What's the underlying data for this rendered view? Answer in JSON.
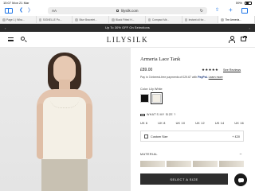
{
  "status_bar": {
    "time": "15:07",
    "date": "Mon 21 Mar",
    "battery": "59%"
  },
  "browser": {
    "aa": "AA",
    "domain": "lilysilk.com",
    "tabs": [
      {
        "label": "Page 1 | Wha..."
      },
      {
        "label": "SIGNELLE Po..."
      },
      {
        "label": "Blue Bracelet..."
      },
      {
        "label": "Black Fitted H..."
      },
      {
        "label": "Compact Mir..."
      },
      {
        "label": "Instant oil for..."
      },
      {
        "label": "The Armeria..."
      }
    ],
    "active_tab": 6
  },
  "promo": {
    "text": "Up To 30% OFF On Selections"
  },
  "header": {
    "brand": "LILYSILK"
  },
  "product": {
    "title": "Armeria Lace Tank",
    "price": "£89.00",
    "stars": "★★★★★",
    "reviews_link": "See Reviews",
    "paypal_prefix": "Pay in 3 interest-free payments of £29.67 with",
    "paypal_brand": "PayPal.",
    "learn_more": "Learn more",
    "color_label": "Color: Lily White",
    "swatches": [
      {
        "name": "Black",
        "hex": "#121212"
      },
      {
        "name": "Lily White",
        "hex": "#f3efe6"
      }
    ],
    "size_guide": "WHAT'S MY SIZE ?",
    "sizes": [
      "UK 6",
      "UK 8",
      "UK 10",
      "UK 12",
      "UK 14",
      "UK 16"
    ],
    "custom_size": {
      "label": "Custom Size",
      "price": "+ £20"
    },
    "material_label": "MATERIAL",
    "material_toggle": "−",
    "cta": "SELECT A SIZE"
  }
}
